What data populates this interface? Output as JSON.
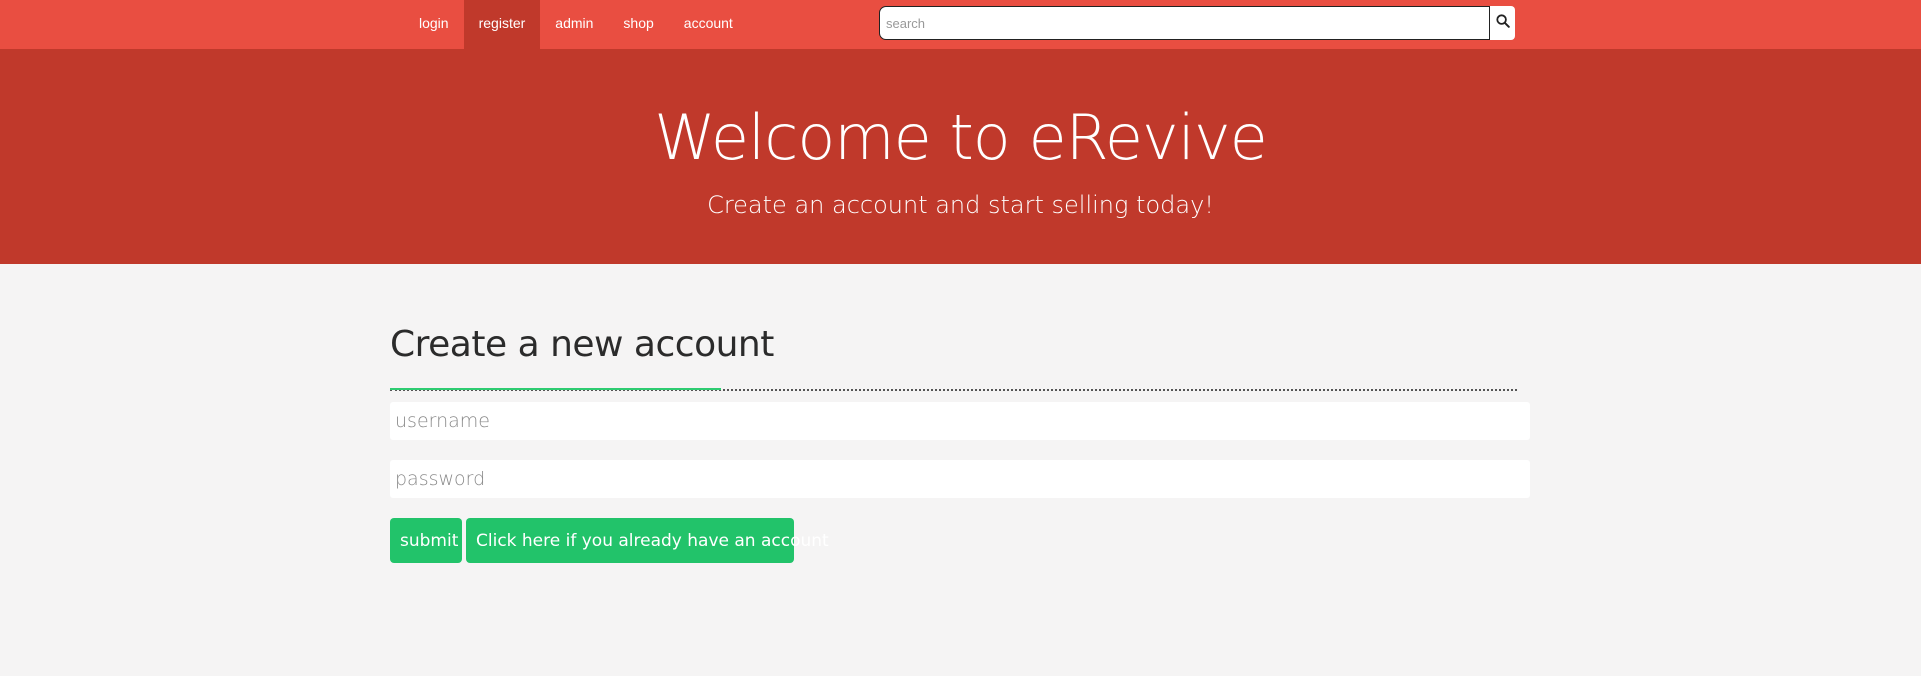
{
  "nav": {
    "links": [
      {
        "label": "login",
        "active": false
      },
      {
        "label": "register",
        "active": true
      },
      {
        "label": "admin",
        "active": false
      },
      {
        "label": "shop",
        "active": false
      },
      {
        "label": "account",
        "active": false
      }
    ],
    "search": {
      "placeholder": "search",
      "value": "",
      "icon": "search-icon"
    }
  },
  "hero": {
    "title": "Welcome to eRevive",
    "subtitle": "Create an account and start selling today!"
  },
  "form": {
    "heading": "Create a new account",
    "username_placeholder": "username",
    "password_placeholder": "password",
    "submit_label": "submit",
    "login_link_label": "Click here if you already have an account"
  },
  "colors": {
    "navbar": "#e94e41",
    "hero": "#c0392b",
    "page_background": "#f5f4f4",
    "accent_green": "#22c36a"
  }
}
